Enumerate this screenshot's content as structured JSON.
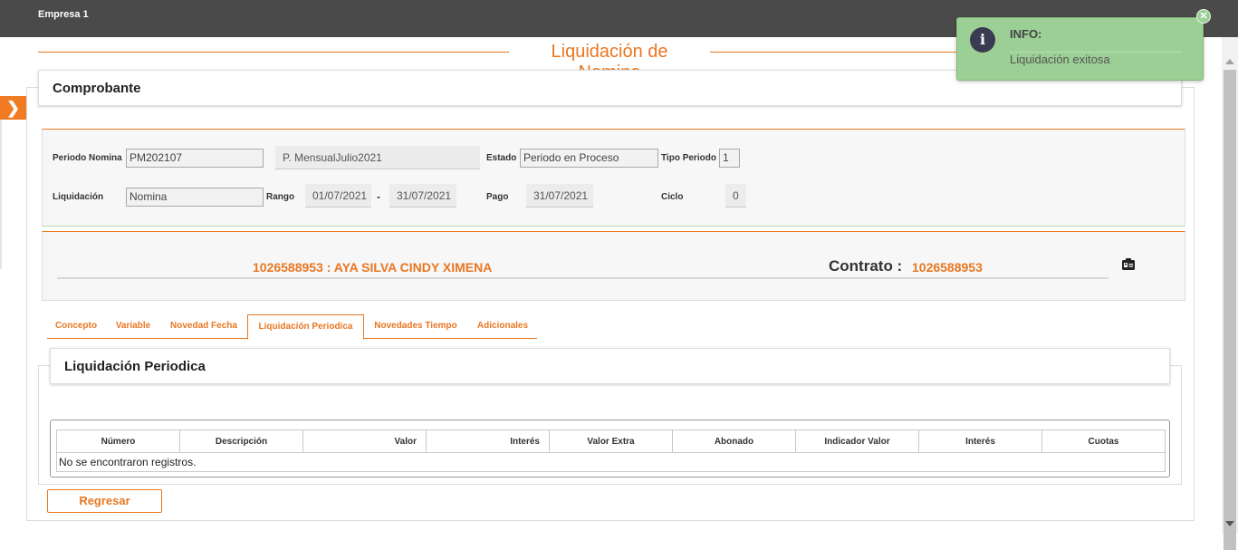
{
  "header": {
    "company": "Empresa 1"
  },
  "page": {
    "title": "Liquidación de Nomina",
    "section_title": "Comprobante"
  },
  "form": {
    "periodo_nomina_label": "Periodo Nomina",
    "periodo_nomina_value": "PM202107",
    "periodo_desc": "P. MensualJulio2021",
    "estado_label": "Estado",
    "estado_value": "Periodo en Proceso",
    "tipo_periodo_label": "Tipo Periodo",
    "tipo_periodo_value": "1",
    "liquidacion_label": "Liquidación",
    "liquidacion_value": "Nomina",
    "rango_label": "Rango",
    "rango_desde": "01/07/2021",
    "rango_sep": "-",
    "rango_hasta": "31/07/2021",
    "pago_label": "Pago",
    "pago_value": "31/07/2021",
    "ciclo_label": "Ciclo",
    "ciclo_value": "0"
  },
  "employee": {
    "name": "1026588953 : AYA SILVA CINDY XIMENA",
    "contrato_label": "Contrato :",
    "contrato_value": "1026588953",
    "icon": "id-card-icon"
  },
  "tabs": [
    {
      "label": "Concepto",
      "active": false
    },
    {
      "label": "Variable",
      "active": false
    },
    {
      "label": "Novedad Fecha",
      "active": false
    },
    {
      "label": "Liquidación Periodica",
      "active": true
    },
    {
      "label": "Novedades Tiempo",
      "active": false
    },
    {
      "label": "Adicionales",
      "active": false
    }
  ],
  "subsection": {
    "title": "Liquidación Periodica"
  },
  "table": {
    "columns": [
      "Número",
      "Descripción",
      "Valor",
      "Interés",
      "Valor Extra",
      "Abonado",
      "Indicador Valor",
      "Interés",
      "Cuotas"
    ],
    "empty_message": "No se encontraron registros."
  },
  "actions": {
    "back_label": "Regresar"
  },
  "toast": {
    "title": "INFO:",
    "message": "Liquidación exitosa",
    "icon": "info-icon",
    "color": "#9ccf95"
  },
  "colors": {
    "accent": "#e87722",
    "topbar": "#4a4a4a"
  }
}
